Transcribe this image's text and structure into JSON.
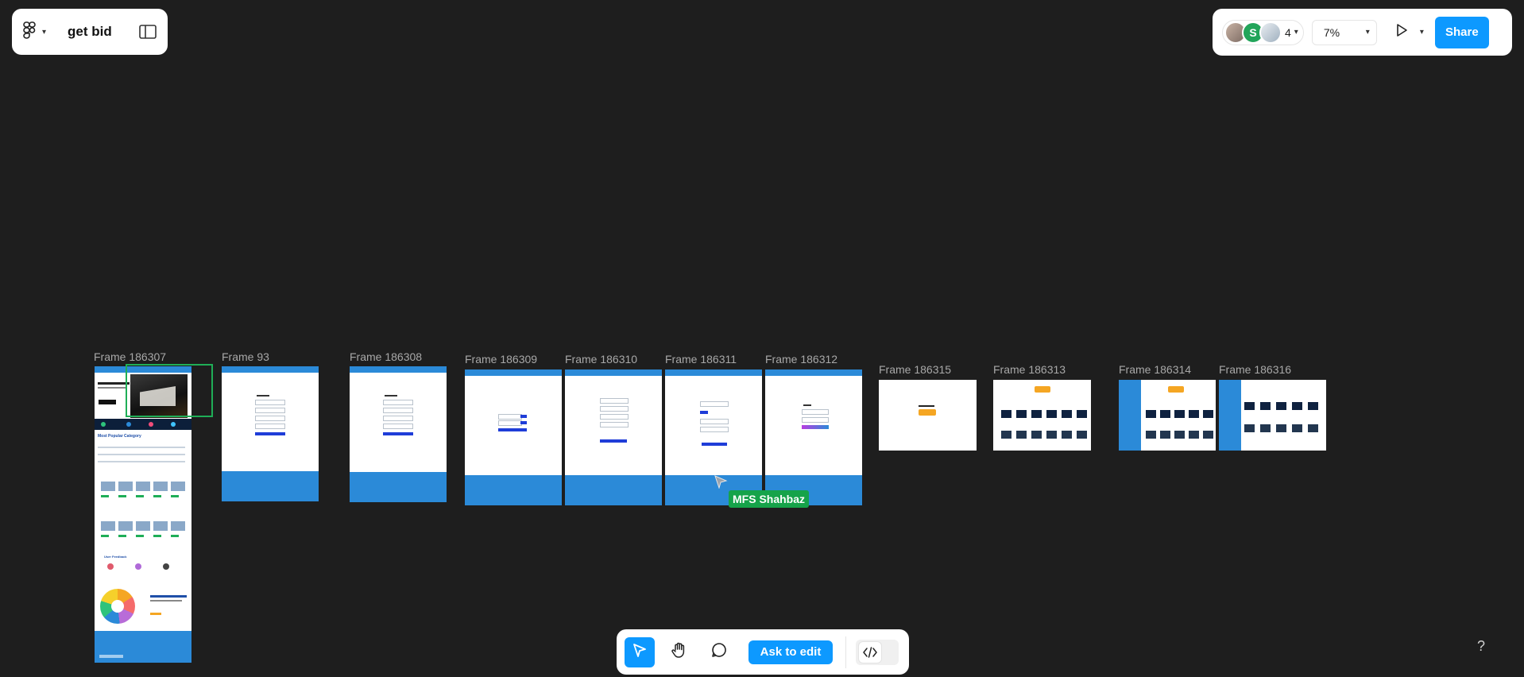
{
  "file": {
    "name": "get bid"
  },
  "collaborators": {
    "avatar_initial": "S",
    "count": "4"
  },
  "zoom": {
    "level": "7%"
  },
  "actions": {
    "share_label": "Share",
    "ask_to_edit_label": "Ask to edit",
    "help_label": "?"
  },
  "frames": [
    {
      "name": "Frame 186307"
    },
    {
      "name": "Frame 93"
    },
    {
      "name": "Frame 186308"
    },
    {
      "name": "Frame 186309"
    },
    {
      "name": "Frame 186310"
    },
    {
      "name": "Frame 186311"
    },
    {
      "name": "Frame 186312"
    },
    {
      "name": "Frame 186315"
    },
    {
      "name": "Frame 186313"
    },
    {
      "name": "Frame 186314"
    },
    {
      "name": "Frame 186316"
    }
  ],
  "frame_content": {
    "home_title": "Most Popular Category",
    "recent_updates": "User Feedback"
  },
  "cursor": {
    "user": "MFS Shahbaz"
  },
  "colors": {
    "accent": "#0d99ff",
    "canvas": "#1e1e1e",
    "frame_blue": "#2b8ad8",
    "cursor_green": "#16a34a"
  },
  "icons": {
    "figma_menu": "figma-logo-icon",
    "sidebar": "sidebar-toggle-icon",
    "present": "play-icon",
    "move": "move-cursor-icon",
    "hand": "hand-icon",
    "comment": "comment-icon",
    "code": "code-icon"
  }
}
